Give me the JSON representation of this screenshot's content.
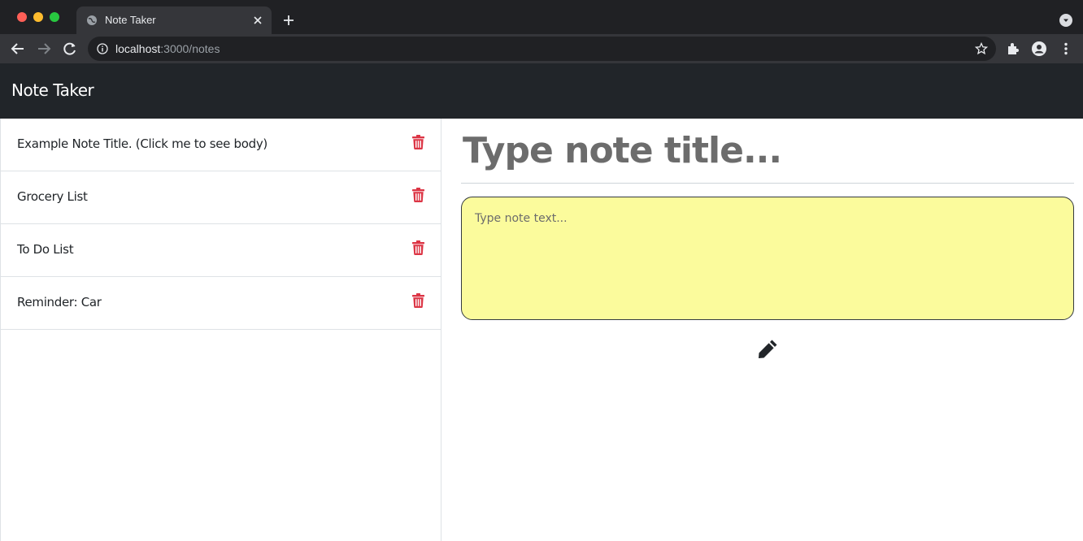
{
  "browser": {
    "tab": {
      "title": "Note Taker"
    },
    "url": {
      "host": "localhost",
      "rest": ":3000/notes"
    },
    "colors": {
      "frame": "#202124",
      "toolbar": "#35363a"
    }
  },
  "app": {
    "brand": "Note Taker",
    "notes": [
      {
        "title": "Example Note Title. (Click me to see body)"
      },
      {
        "title": "Grocery List"
      },
      {
        "title": "To Do List"
      },
      {
        "title": "Reminder: Car"
      }
    ],
    "editor": {
      "title_placeholder": "Type note title...",
      "text_placeholder": "Type note text..."
    },
    "icons": {
      "delete": "trash-icon",
      "save": "pencil-icon"
    },
    "colors": {
      "navbar": "#212529",
      "delete": "#dc3545",
      "note_bg": "#fbfb9c",
      "title_text": "#6c6c6c"
    }
  }
}
